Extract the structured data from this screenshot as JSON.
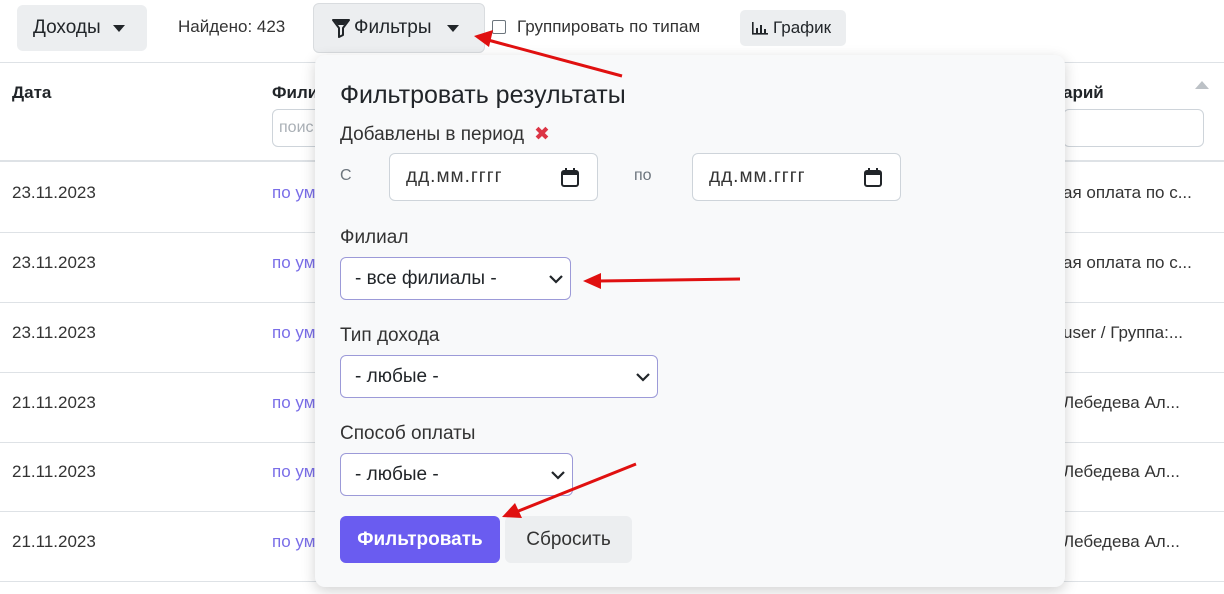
{
  "toolbar": {
    "income_dropdown": "Доходы",
    "found_label": "Найдено: 423",
    "filters_button": "Фильтры",
    "group_by_types": "Группировать по типам",
    "chart_button": "График"
  },
  "table": {
    "headers": {
      "date": "Дата",
      "branch": "Фили",
      "comment": "арий"
    },
    "branch_filter_placeholder": "поис",
    "rows": [
      {
        "date": "23.11.2023",
        "branch": "по ум",
        "comment": "ая оплата по с..."
      },
      {
        "date": "23.11.2023",
        "branch": "по ум",
        "comment": "ая оплата по с..."
      },
      {
        "date": "23.11.2023",
        "branch": "по ум",
        "comment": "user / Группа:..."
      },
      {
        "date": "21.11.2023",
        "branch": "по ум",
        "comment": "Лебедева Ал..."
      },
      {
        "date": "21.11.2023",
        "branch": "по ум",
        "comment": "Лебедева Ал..."
      },
      {
        "date": "21.11.2023",
        "branch": "по ум",
        "comment": "Лебедева Ал..."
      }
    ]
  },
  "filter_panel": {
    "title": "Фильтровать результаты",
    "period_label": "Добавлены в период",
    "from_label": "С",
    "to_label": "по",
    "from_placeholder": "дд.мм.гггг",
    "to_placeholder": "дд.мм.гггг",
    "branch_label": "Филиал",
    "branch_value": "- все филиалы -",
    "income_type_label": "Тип дохода",
    "income_type_value": "- любые -",
    "payment_method_label": "Способ оплаты",
    "payment_method_value": "- любые -",
    "submit_button": "Фильтровать",
    "reset_button": "Сбросить"
  },
  "colors": {
    "accent": "#6a5cf0",
    "link": "#7a6ee8",
    "annotation_arrow": "#e01010",
    "clear_x": "#dc3545"
  }
}
